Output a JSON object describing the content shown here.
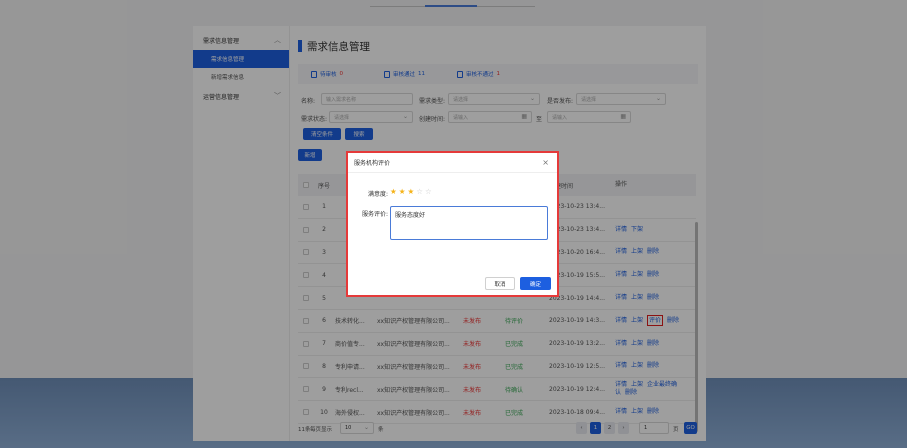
{
  "sidebar": {
    "groups": [
      {
        "label": "需求信息管理",
        "items": [
          "需求信息管理",
          "新增需求信息"
        ]
      },
      {
        "label": "运营信息管理",
        "items": []
      }
    ]
  },
  "page": {
    "title": "需求信息管理"
  },
  "status_tabs": [
    {
      "label": "待审核",
      "count": "0"
    },
    {
      "label": "审核通过",
      "count": "11"
    },
    {
      "label": "审核不通过",
      "count": "1"
    }
  ],
  "filters": {
    "name_label": "名称:",
    "name_placeholder": "输入需求名称",
    "type_label": "需求类型:",
    "type_placeholder": "请选择",
    "publish_label": "是否发布:",
    "publish_placeholder": "请选择",
    "state_label": "需求状态:",
    "state_placeholder": "请选择",
    "time_label": "创建时间:",
    "start_placeholder": "请输入",
    "range_sep": "至",
    "end_placeholder": "请输入",
    "clear_label": "清空条件",
    "search_label": "搜索"
  },
  "toolbar": {
    "add_label": "新增"
  },
  "table": {
    "columns": [
      "序号",
      "创建时间",
      "操作"
    ],
    "rows": [
      {
        "no": "1",
        "name": "",
        "org": "",
        "pub": "",
        "state": "",
        "time": "2023-10-23 13:4...",
        "ops": []
      },
      {
        "no": "2",
        "name": "",
        "org": "",
        "pub": "",
        "state": "",
        "time": "2023-10-23 13:4...",
        "ops": [
          "详情",
          "下架"
        ]
      },
      {
        "no": "3",
        "name": "",
        "org": "",
        "pub": "",
        "state": "",
        "time": "2023-10-20 16:4...",
        "ops": [
          "详情",
          "上架",
          "删除"
        ]
      },
      {
        "no": "4",
        "name": "",
        "org": "",
        "pub": "",
        "state": "",
        "time": "2023-10-19 15:5...",
        "ops": [
          "详情",
          "上架",
          "删除"
        ]
      },
      {
        "no": "5",
        "name": "",
        "org": "",
        "pub": "",
        "state": "",
        "time": "2023-10-19 14:4...",
        "ops": [
          "详情",
          "上架",
          "删除"
        ]
      },
      {
        "no": "6",
        "name": "技术转化...",
        "org": "xx知识产权管理有限公司...",
        "pub": "未发布",
        "state": "待评价",
        "time": "2023-10-19 14:3...",
        "ops": [
          "详情",
          "上架",
          "评价",
          "删除"
        ]
      },
      {
        "no": "7",
        "name": "商价值专...",
        "org": "xx知识产权管理有限公司...",
        "pub": "未发布",
        "state": "已完成",
        "time": "2023-10-19 13:2...",
        "ops": [
          "详情",
          "上架",
          "删除"
        ]
      },
      {
        "no": "8",
        "name": "专利申请...",
        "org": "xx知识产权管理有限公司...",
        "pub": "未发布",
        "state": "已完成",
        "time": "2023-10-19 12:5...",
        "ops": [
          "详情",
          "上架",
          "删除"
        ]
      },
      {
        "no": "9",
        "name": "专利recl...",
        "org": "xx知识产权管理有限公司...",
        "pub": "未发布",
        "state": "待确认",
        "time": "2023-10-19 12:4...",
        "ops": [
          "详情",
          "上架",
          "企业最终确认",
          "删除"
        ]
      },
      {
        "no": "10",
        "name": "海外侵权...",
        "org": "xx知识产权管理有限公司...",
        "pub": "未发布",
        "state": "已完成",
        "time": "2023-10-18 09:4...",
        "ops": [
          "详情",
          "上架",
          "删除"
        ]
      }
    ]
  },
  "pager": {
    "total": "11条",
    "per_page_label": "每页显示",
    "per_page": "10",
    "unit": "条",
    "pages": [
      "1",
      "2"
    ],
    "current": "1",
    "jump_value": "1",
    "page_unit": "页",
    "go": "GO"
  },
  "dialog": {
    "title": "服务机构评价",
    "rating_label": "满意度:",
    "rating": 2.5,
    "rating_max": 5,
    "comment_label": "服务评价:",
    "comment_value": "服务态度好",
    "cancel_label": "取消",
    "ok_label": "确定"
  },
  "colors": {
    "accent": "#1d5fe0",
    "danger": "#e33333",
    "success": "#3aa856",
    "highlight": "#e02020"
  }
}
